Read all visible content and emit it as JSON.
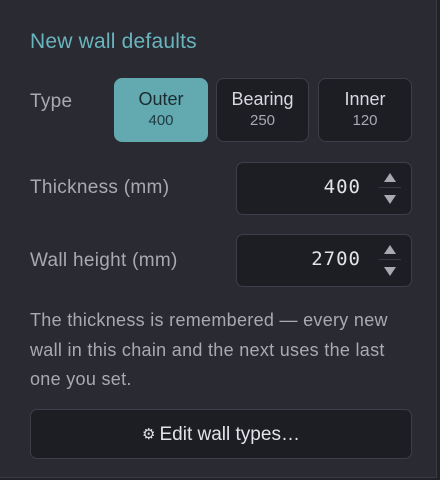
{
  "panel": {
    "title": "New wall defaults",
    "accent_color": "#6ab4bd"
  },
  "type_selector": {
    "label": "Type",
    "selected": "Outer",
    "options": [
      {
        "name": "Outer",
        "thickness": "400"
      },
      {
        "name": "Bearing",
        "thickness": "250"
      },
      {
        "name": "Inner",
        "thickness": "120"
      }
    ]
  },
  "thickness": {
    "label": "Thickness (mm)",
    "value": "400"
  },
  "wall_height": {
    "label": "Wall height (mm)",
    "value": "2700"
  },
  "help_text": "The thickness is remembered — every new wall in this chain and the next uses the last one you set.",
  "edit_button": {
    "icon": "gear-icon",
    "label": "Edit wall types…"
  }
}
